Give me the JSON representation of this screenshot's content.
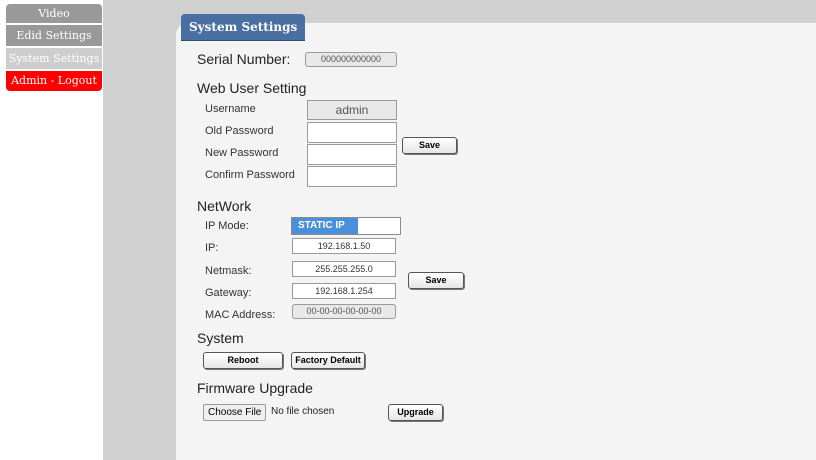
{
  "sidebar": {
    "items": [
      {
        "label": "Video"
      },
      {
        "label": "Edid Settings"
      },
      {
        "label": "System Settings"
      },
      {
        "label": "Admin - Logout"
      }
    ]
  },
  "panel": {
    "title": "System Settings"
  },
  "serial": {
    "label": "Serial Number:",
    "value": "000000000000"
  },
  "web_user": {
    "heading": "Web User Setting",
    "username_label": "Username",
    "username_value": "admin",
    "old_password_label": "Old Password",
    "new_password_label": "New Password",
    "confirm_password_label": "Confirm Password",
    "save_label": "Save"
  },
  "network": {
    "heading": "NetWork",
    "ip_mode_label": "IP Mode:",
    "ip_mode_value": "STATIC IP",
    "ip_label": "IP:",
    "ip_value": "192.168.1.50",
    "netmask_label": "Netmask:",
    "netmask_value": "255.255.255.0",
    "gateway_label": "Gateway:",
    "gateway_value": "192.168.1.254",
    "mac_label": "MAC Address:",
    "mac_value": "00-00-00-00-00-00",
    "save_label": "Save"
  },
  "system": {
    "heading": "System",
    "reboot_label": "Reboot",
    "factory_default_label": "Factory Default"
  },
  "firmware": {
    "heading": "Firmware Upgrade",
    "choose_file_label": "Choose File",
    "no_file_text": "No file chosen",
    "upgrade_label": "Upgrade"
  },
  "colors": {
    "tab_blue": "#4a6fa1",
    "nav_gray": "#999999",
    "nav_active": "#cdcdcd",
    "logout_red": "#ff0000",
    "toggle_blue": "#4a8fd9"
  }
}
